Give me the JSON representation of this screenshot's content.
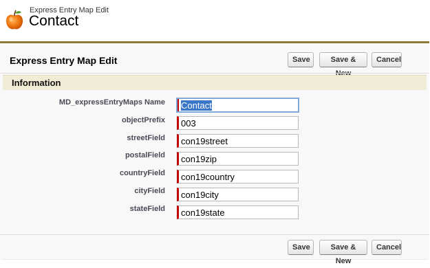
{
  "header": {
    "subtitle": "Express Entry Map Edit",
    "title": "Contact",
    "icon": "apple-icon"
  },
  "block": {
    "title": "Express Entry Map Edit"
  },
  "buttons": {
    "save": "Save",
    "save_new": "Save & New",
    "cancel": "Cancel"
  },
  "section": {
    "title": "Information"
  },
  "fields": [
    {
      "label": "MD_expressEntryMaps Name",
      "value": "Contact"
    },
    {
      "label": "objectPrefix",
      "value": "003"
    },
    {
      "label": "streetField",
      "value": "con19street"
    },
    {
      "label": "postalField",
      "value": "con19zip"
    },
    {
      "label": "countryField",
      "value": "con19country"
    },
    {
      "label": "cityField",
      "value": "con19city"
    },
    {
      "label": "stateField",
      "value": "con19state"
    }
  ],
  "colors": {
    "accent": "#8b7b33",
    "required": "#c00000",
    "section_bg": "#f0ecd6"
  }
}
